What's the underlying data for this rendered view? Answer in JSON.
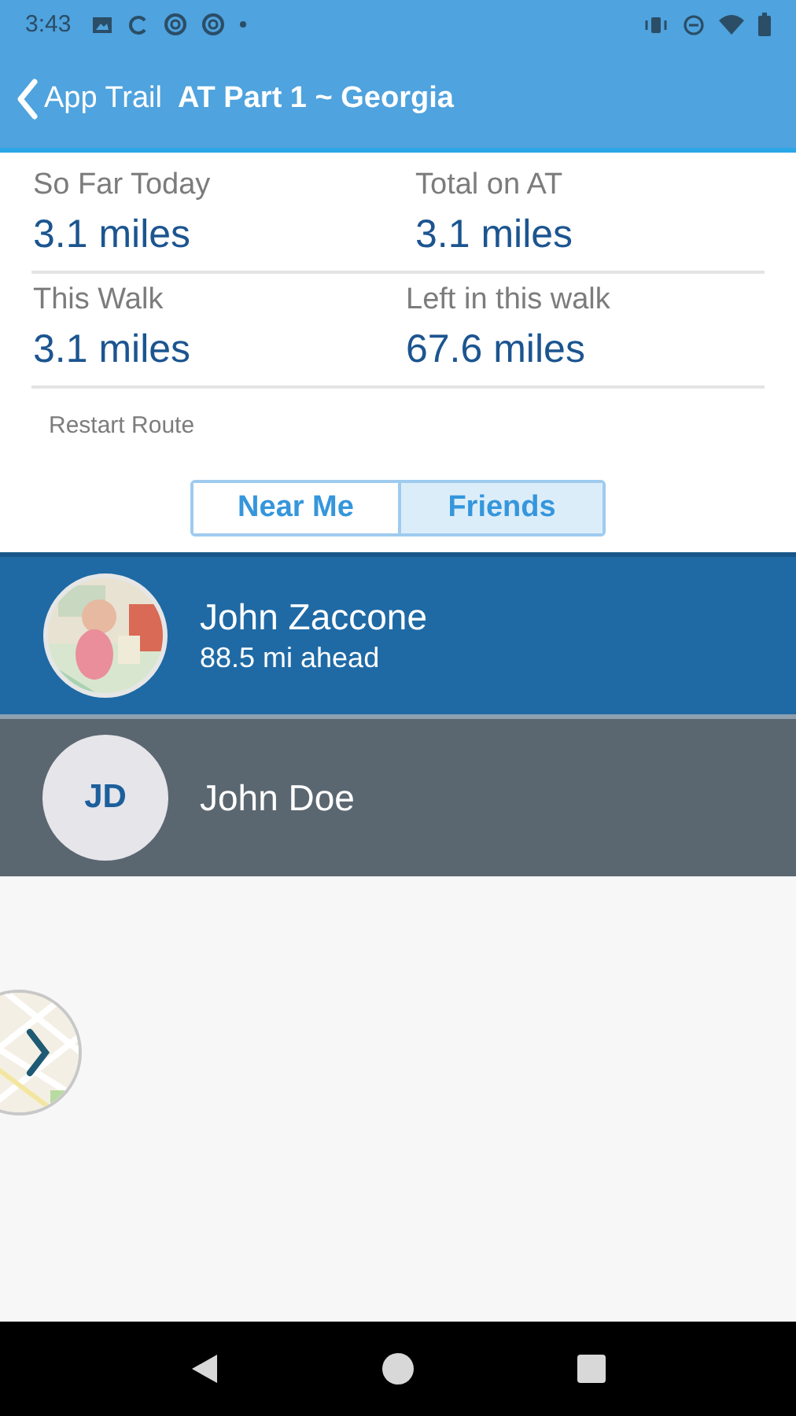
{
  "status_bar": {
    "time": "3:43"
  },
  "app_bar": {
    "back_label": "App Trail",
    "title": "AT Part 1 ~ Georgia"
  },
  "stats": [
    {
      "label": "So Far Today",
      "value": "3.1 miles"
    },
    {
      "label": "Total on AT",
      "value": "3.1 miles"
    },
    {
      "label": "This Walk",
      "value": "3.1 miles"
    },
    {
      "label": "Left in this walk",
      "value": "67.6 miles"
    }
  ],
  "restart_link": "Restart Route",
  "tabs": [
    {
      "label": "Near Me",
      "selected": false
    },
    {
      "label": "Friends",
      "selected": true
    }
  ],
  "friends": [
    {
      "name": "John Zaccone",
      "detail": "88.5 mi ahead",
      "selected": true
    },
    {
      "name": "John Doe",
      "avatar": {
        "kind": "initials",
        "text": "JD"
      },
      "selected": false
    }
  ]
}
